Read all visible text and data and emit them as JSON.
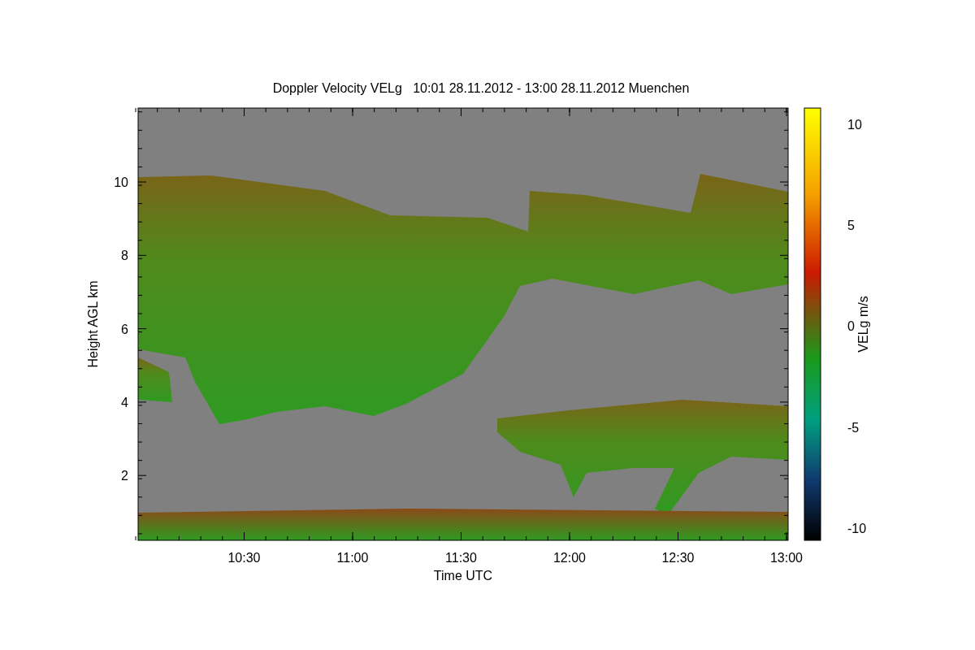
{
  "title": "Doppler Velocity VELg   10:01 28.11.2012 - 13:00 28.11.2012 Muenchen",
  "xlabel": "Time UTC",
  "ylabel": "Height AGL km",
  "xticks": [
    "10:30",
    "11:00",
    "11:30",
    "12:00",
    "12:30",
    "13:00"
  ],
  "yticks": [
    "10",
    "8",
    "6",
    "4",
    "2"
  ],
  "colorbar": {
    "label": "VELg m/s",
    "ticks": [
      "10",
      "5",
      "0",
      "-5",
      "-10"
    ]
  }
}
